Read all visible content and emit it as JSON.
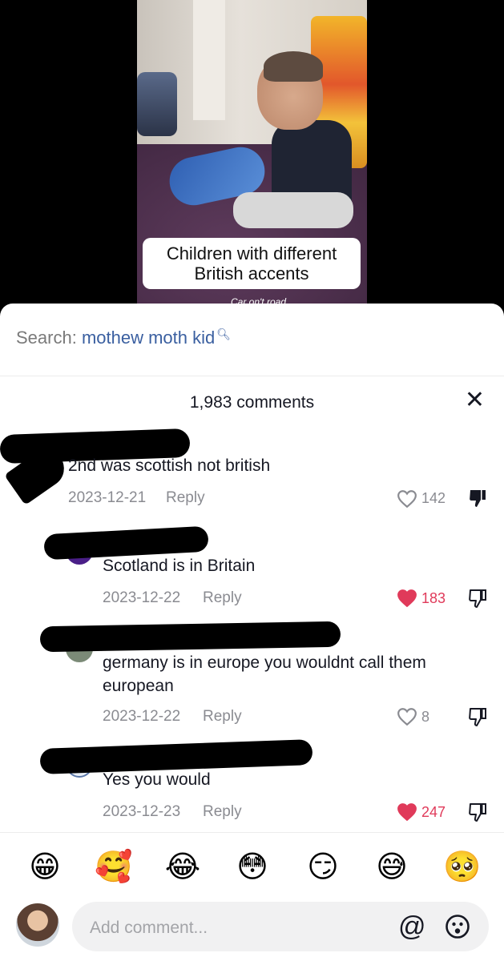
{
  "video": {
    "caption": "Children with different British accents",
    "subtext": "Car on't road"
  },
  "search": {
    "prefix": "Search:",
    "term": "mothew moth kid"
  },
  "comments_header": {
    "title": "1,983 comments"
  },
  "comments": [
    {
      "text": "2nd was scottish not british",
      "date": "2023-12-21",
      "reply_label": "Reply",
      "likes": "142",
      "liked": false,
      "disliked": true
    },
    {
      "text": "Scotland is in Britain",
      "date": "2023-12-22",
      "reply_label": "Reply",
      "likes": "183",
      "liked": true,
      "disliked": false
    },
    {
      "text": "germany is in europe you wouldnt call them european",
      "date": "2023-12-22",
      "reply_label": "Reply",
      "likes": "8",
      "liked": false,
      "disliked": false
    },
    {
      "text": "Yes you would",
      "date": "2023-12-23",
      "reply_label": "Reply",
      "likes": "247",
      "liked": true,
      "disliked": false
    }
  ],
  "emoji_bar": [
    "😁",
    "🥰",
    "😂",
    "😳",
    "😏",
    "😅",
    "🥺"
  ],
  "composer": {
    "placeholder": "Add comment...",
    "mention_symbol": "@"
  },
  "colors": {
    "liked_heart": "#e03a5a",
    "search_term": "#3a5fa0",
    "meta_grey": "#8a8b91"
  }
}
